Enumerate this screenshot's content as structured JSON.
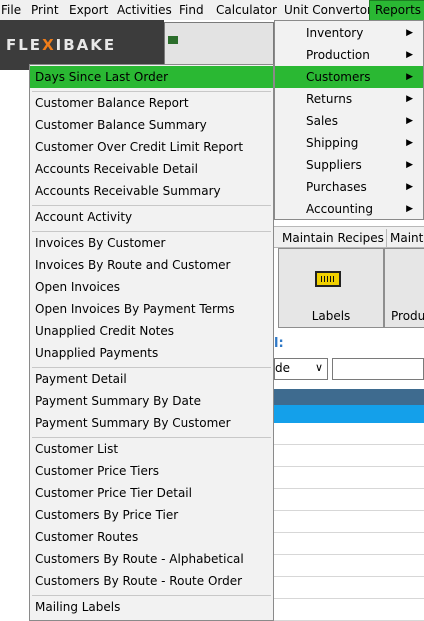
{
  "menubar": {
    "items": [
      "File",
      "Print",
      "Export",
      "Activities",
      "Find",
      "Calculator",
      "Unit Convertor",
      "Reports"
    ]
  },
  "logo": {
    "text_start": "FLE",
    "text_x": "X",
    "text_end": "IBAKE"
  },
  "background": {
    "tabs": [
      "Maintain Recipes",
      "Mainta"
    ],
    "tiles": [
      {
        "label": "Labels",
        "icon": "labels-icon"
      },
      {
        "label": "Produ"
      }
    ],
    "section_colon": "l:",
    "select_value": "de",
    "select_chevron": "∨"
  },
  "reports_menu": {
    "items": [
      {
        "label": "Inventory"
      },
      {
        "label": "Production"
      },
      {
        "label": "Customers"
      },
      {
        "label": "Returns"
      },
      {
        "label": "Sales"
      },
      {
        "label": "Shipping"
      },
      {
        "label": "Suppliers"
      },
      {
        "label": "Purchases"
      },
      {
        "label": "Accounting"
      }
    ],
    "arrow": "▶",
    "active": "Customers"
  },
  "customers_menu": {
    "items": [
      "Days Since Last Order",
      "Customer Balance Report",
      "Customer Balance Summary",
      "Customer Over Credit Limit Report",
      "Accounts Receivable Detail",
      "Accounts Receivable Summary",
      "Account Activity",
      "Invoices By Customer",
      "Invoices By Route and Customer",
      "Open Invoices",
      "Open Invoices By Payment Terms",
      "Unapplied Credit Notes",
      "Unapplied Payments",
      "Payment Detail",
      "Payment Summary By Date",
      "Payment Summary By Customer",
      "Customer List",
      "Customer Price Tiers",
      "Customer Price Tier Detail",
      "Customers By Price Tier",
      "Customer Routes",
      "Customers By Route - Alphabetical",
      "Customers By Route - Route Order",
      "Mailing Labels"
    ],
    "active": "Days Since Last Order"
  },
  "colors": {
    "highlight_green": "#2ab833",
    "menu_bg": "#f2f2f2",
    "grid_select": "#14a0ea",
    "grid_header": "#3e6b8f",
    "accent_text": "#2f78c6",
    "logo_orange": "#f07d1a"
  }
}
